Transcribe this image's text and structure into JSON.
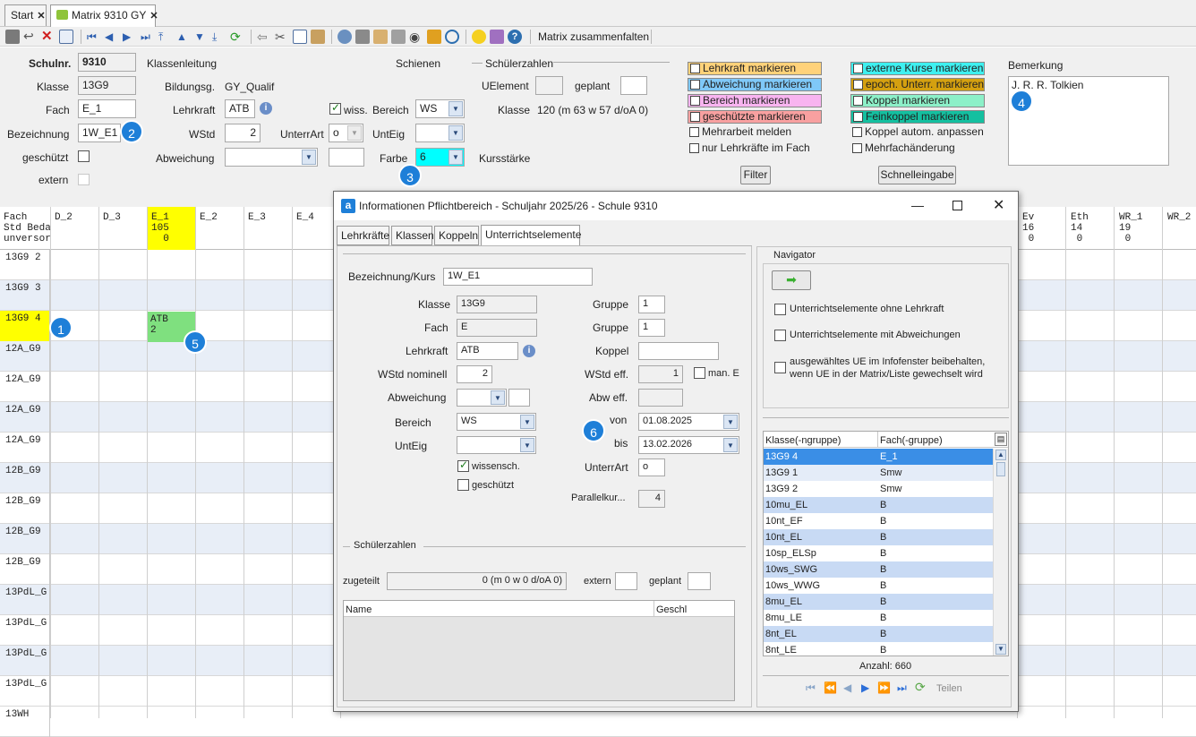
{
  "tabs": [
    {
      "label": "Start"
    },
    {
      "label": "Matrix 9310 GY"
    }
  ],
  "toolbar": {
    "collapse_label": "Matrix zusammenfalten"
  },
  "form": {
    "schulnr_label": "Schulnr.",
    "schulnr": "9310",
    "klassenleitung_label": "Klassenleitung",
    "schienen_label": "Schienen",
    "schuelerzahlen_label": "Schülerzahlen",
    "klasse_label": "Klasse",
    "klasse": "13G9",
    "bildungsg_label": "Bildungsg.",
    "bildungsg": "GY_Qualif",
    "uelement_label": "UElement",
    "geplant_label": "geplant",
    "fach_label": "Fach",
    "fach": "E_1",
    "lehrkraft_label": "Lehrkraft",
    "lehrkraft": "ATB",
    "wiss_label": "wiss.",
    "bereich_label": "Bereich",
    "bereich": "WS",
    "klasse2_label": "Klasse",
    "klasse2_value": "120 (m 63 w 57 d/oA 0)",
    "bezeichnung_label": "Bezeichnung",
    "bezeichnung": "1W_E1",
    "wstd_label": "WStd",
    "wstd": "2",
    "unterrart_label": "UnterrArt",
    "unterrart": "o",
    "unteig_label": "UntEig",
    "geschuetzt_label": "geschützt",
    "abweichung_label": "Abweichung",
    "farbe_label": "Farbe",
    "farbe": "6",
    "kursstaerke_label": "Kursstärke",
    "extern_label": "extern",
    "marks_left": [
      {
        "label": "Lehrkraft markieren",
        "color": "#ffd27a"
      },
      {
        "label": "Abweichung markieren",
        "color": "#7fc8f8"
      },
      {
        "label": "Bereich markieren",
        "color": "#f8b4f0"
      },
      {
        "label": "geschützte markieren",
        "color": "#f8a0a0"
      },
      {
        "label": "Mehrarbeit melden",
        "color": "#f0f0f0"
      },
      {
        "label": "nur Lehrkräfte im Fach",
        "color": "#f0f0f0"
      }
    ],
    "marks_right": [
      {
        "label": "externe Kurse markieren",
        "color": "#3ef0f0"
      },
      {
        "label": "epoch. Unterr. markieren",
        "color": "#d4a010"
      },
      {
        "label": "Koppel markieren",
        "color": "#8cf0c8"
      },
      {
        "label": "Feinkoppel markieren",
        "color": "#14c0a0"
      },
      {
        "label": "Koppel autom. anpassen",
        "color": "#f0f0f0"
      },
      {
        "label": "Mehrfachänderung",
        "color": "#f0f0f0"
      }
    ],
    "filter_label": "Filter",
    "schnelleingabe_label": "Schnelleingabe",
    "bemerkung_label": "Bemerkung",
    "bemerkung": "J. R. R. Tolkien"
  },
  "badges": [
    "1",
    "2",
    "3",
    "4",
    "5",
    "6"
  ],
  "grid": {
    "corner": "Fach\nStd Bedarf\nunversorgt",
    "cols_left": [
      {
        "h": "D_2"
      },
      {
        "h": "D_3"
      },
      {
        "h": "E_1\n105\n  0",
        "highlight": true
      },
      {
        "h": "E_2"
      },
      {
        "h": "E_3"
      },
      {
        "h": "E_4"
      }
    ],
    "cols_right": [
      {
        "h": "Ev\n16\n 0"
      },
      {
        "h": "Eth\n14\n 0"
      },
      {
        "h": "WR_1\n19\n 0"
      },
      {
        "h": "WR_2"
      }
    ],
    "rows": [
      "13G9 2",
      "13G9 3",
      "13G9 4",
      "12A_G9",
      "12A_G9",
      "12A_G9",
      "12A_G9",
      "12B_G9",
      "12B_G9",
      "12B_G9",
      "12B_G9",
      "13PdL_G",
      "13PdL_G",
      "13PdL_G",
      "13PdL_G",
      "13WH"
    ],
    "cell_atb": "ATB\n2"
  },
  "dialog": {
    "title": "Informationen Pflichtbereich - Schuljahr 2025/26 - Schule 9310",
    "tabs": [
      "Lehrkräfte",
      "Klassen",
      "Koppeln",
      "Unterrichtselemente"
    ],
    "bez_label": "Bezeichnung/Kurs",
    "bez": "1W_E1",
    "klasse_label": "Klasse",
    "klasse": "13G9",
    "gruppe_label": "Gruppe",
    "gruppe1": "1",
    "fach_label": "Fach",
    "fach": "E",
    "gruppe2": "1",
    "lehrkraft_label": "Lehrkraft",
    "lehrkraft": "ATB",
    "koppel_label": "Koppel",
    "wstd_label": "WStd nominell",
    "wstd": "2",
    "wstdeff_label": "WStd eff.",
    "wstdeff": "1",
    "mane_label": "man. E",
    "abw_label": "Abweichung",
    "abweff_label": "Abw eff.",
    "bereich_label": "Bereich",
    "bereich": "WS",
    "von_label": "von",
    "von": "01.08.2025",
    "unteig_label": "UntEig",
    "bis_label": "bis",
    "bis": "13.02.2026",
    "wiss_label": "wissensch.",
    "unterrart_label": "UnterrArt",
    "unterrart": "o",
    "gesch_label": "geschützt",
    "parallel_label": "Parallelkur...",
    "parallel": "4",
    "schueler_label": "Schülerzahlen",
    "zugeteilt_label": "zugeteilt",
    "zugeteilt": "0 (m 0 w 0 d/oA 0)",
    "extern_label": "extern",
    "geplant_label": "geplant",
    "col_name": "Name",
    "col_geschl": "Geschl",
    "nav_label": "Navigator",
    "opt1": "Unterrichtselemente ohne Lehrkraft",
    "opt2": "Unterrichtselemente mit Abweichungen",
    "opt3a": "ausgewähltes UE im Infofenster beibehalten,",
    "opt3b": "wenn UE in der Matrix/Liste gewechselt wird",
    "list_h1": "Klasse(-ngruppe)",
    "list_h2": "Fach(-gruppe)",
    "list": [
      [
        "13G9 4",
        "E_1"
      ],
      [
        "13G9 1",
        "Smw"
      ],
      [
        "13G9 2",
        "Smw"
      ],
      [
        "10mu_EL",
        "B"
      ],
      [
        "10nt_EF",
        "B"
      ],
      [
        "10nt_EL",
        "B"
      ],
      [
        "10sp_ELSp",
        "B"
      ],
      [
        "10ws_SWG",
        "B"
      ],
      [
        "10ws_WWG",
        "B"
      ],
      [
        "8mu_EL",
        "B"
      ],
      [
        "8mu_LE",
        "B"
      ],
      [
        "8nt_EL",
        "B"
      ],
      [
        "8nt_LE",
        "B"
      ]
    ],
    "anzahl": "Anzahl: 660",
    "teilen": "Teilen"
  }
}
